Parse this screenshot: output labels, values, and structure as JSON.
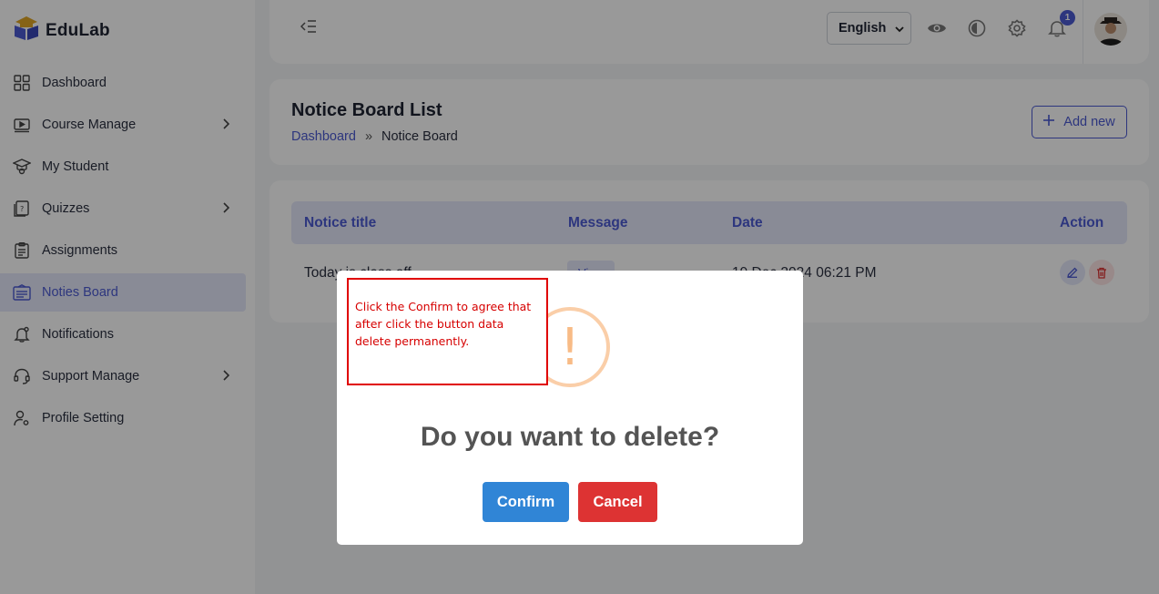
{
  "brand": {
    "name": "EduLab"
  },
  "sidebar": {
    "items": [
      {
        "label": "Dashboard",
        "icon": "grid-icon",
        "has_submenu": false,
        "active": false
      },
      {
        "label": "Course Manage",
        "icon": "video-icon",
        "has_submenu": true,
        "active": false
      },
      {
        "label": "My Student",
        "icon": "graduation-icon",
        "has_submenu": false,
        "active": false
      },
      {
        "label": "Quizzes",
        "icon": "quiz-icon",
        "has_submenu": true,
        "active": false
      },
      {
        "label": "Assignments",
        "icon": "clipboard-icon",
        "has_submenu": false,
        "active": false
      },
      {
        "label": "Noties Board",
        "icon": "notice-icon",
        "has_submenu": false,
        "active": true
      },
      {
        "label": "Notifications",
        "icon": "bell-icon",
        "has_submenu": false,
        "active": false
      },
      {
        "label": "Support Manage",
        "icon": "headset-icon",
        "has_submenu": true,
        "active": false
      },
      {
        "label": "Profile Setting",
        "icon": "user-gear-icon",
        "has_submenu": false,
        "active": false
      }
    ]
  },
  "header": {
    "language": "English",
    "notification_count": "1"
  },
  "page": {
    "title": "Notice Board List",
    "breadcrumb": {
      "home": "Dashboard",
      "separator": "»",
      "current": "Notice Board"
    },
    "add_button": "Add new"
  },
  "table": {
    "headers": {
      "title": "Notice title",
      "message": "Message",
      "date": "Date",
      "action": "Action"
    },
    "rows": [
      {
        "title": "Today is class off",
        "message_button": "View",
        "date": "19 Dec 2024 06:21 PM"
      }
    ]
  },
  "modal": {
    "icon": "!",
    "title": "Do you want to delete?",
    "confirm": "Confirm",
    "cancel": "Cancel"
  },
  "annotation": {
    "text": "Click the Confirm to agree that after click the button data delete permanently."
  },
  "colors": {
    "accent": "#4c5ad2",
    "confirm": "#3085d6",
    "cancel": "#dd3333",
    "warning": "#f8bb86",
    "annotation": "#e00000"
  }
}
